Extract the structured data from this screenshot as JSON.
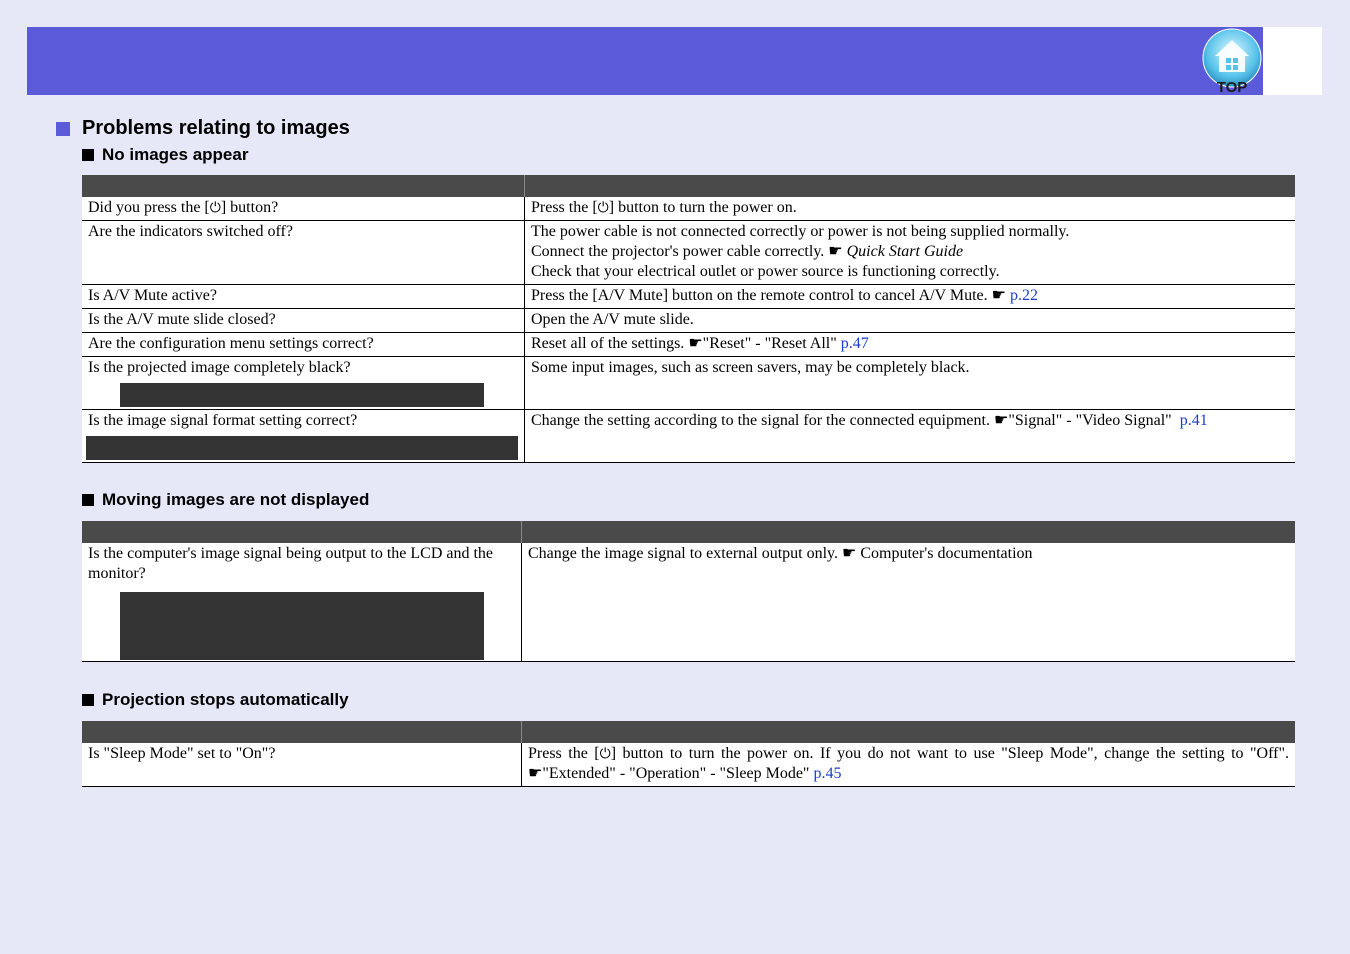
{
  "header": {
    "top_label": "TOP"
  },
  "section": {
    "title": "Problems relating to images"
  },
  "tables": {
    "no_images": {
      "title": "No images appear",
      "rows": [
        {
          "q_pre": "Did you press the [",
          "q_post": "] button?",
          "a_pre": "Press the [",
          "a_post": "] button to turn the power on."
        },
        {
          "q": "Are the indicators switched off?",
          "a1": "The power cable is not connected correctly or power is not being supplied normally.",
          "a2": "Connect the projector's power cable correctly.",
          "a2_ref": "Quick Start Guide",
          "a3": "Check that your electrical outlet or power source is functioning correctly."
        },
        {
          "q": "Is A/V Mute active?",
          "a": "Press the [A/V Mute] button on the remote control to cancel A/V Mute.",
          "link": "p.22"
        },
        {
          "q": "Is the A/V mute slide closed?",
          "a": "Open the A/V mute slide."
        },
        {
          "q": "Are the configuration menu settings correct?",
          "a": "Reset all of the settings. ",
          "a_ref": "\"Reset\" - \"Reset All\"",
          "link": "p.47"
        },
        {
          "q": "Is the projected image completely black?",
          "a": "Some input images, such as screen savers, may be completely black."
        },
        {
          "q": "Is the image signal format setting correct?",
          "a": "Change the setting according to the signal for the connected equipment. ",
          "a_ref": "\"Signal\" - \"Video Signal\"",
          "link": "p.41"
        }
      ]
    },
    "moving": {
      "title": "Moving images are not displayed",
      "rows": [
        {
          "q": "Is the computer's image signal being output to the LCD and the monitor?",
          "a": "Change the image signal to external output only.",
          "a_ref": "Computer's documentation"
        }
      ]
    },
    "stops": {
      "title": "Projection stops automatically",
      "rows": [
        {
          "q": "Is \"Sleep Mode\" set to \"On\"?",
          "a_pre": "Press the [",
          "a_mid": "] button to turn the power on. If you do not want to use \"Sleep Mode\", change the setting to \"Off\". ",
          "a_ref": "\"Extended\" - \"Operation\" - \"Sleep Mode\"",
          "link": "p.45"
        }
      ]
    }
  },
  "glyphs": {
    "power": "⏻",
    "pointer": "☛"
  },
  "colors": {
    "header": "#5b5bd9",
    "background": "#e6e8f8",
    "table_header": "#4a4a4a",
    "link": "#1a3fcc"
  }
}
